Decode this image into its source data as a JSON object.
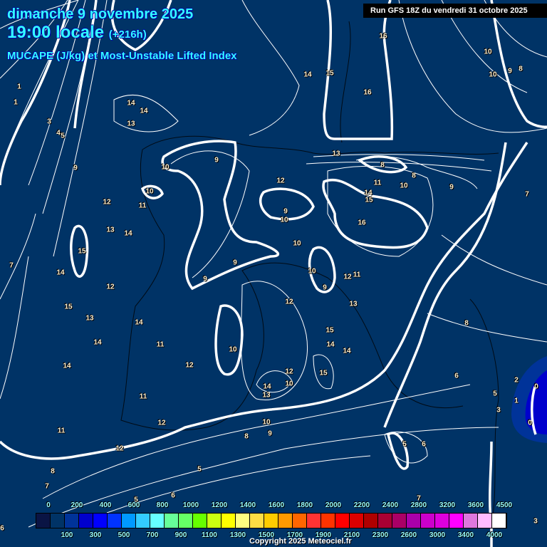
{
  "header": {
    "date": "dimanche 9 novembre 2025",
    "time": "19:00 locale",
    "lead": "(+216h)",
    "product": "MUCAPE (J/kg) et Most-Unstable Lifted Index",
    "run": "Run GFS 18Z du vendredi 31 octobre 2025"
  },
  "contour_labels": [
    "1",
    "1",
    "3",
    "4",
    "5",
    "9",
    "7",
    "14",
    "14",
    "13",
    "10",
    "9",
    "10",
    "12",
    "11",
    "13",
    "14",
    "15",
    "14",
    "12",
    "15",
    "13",
    "14",
    "14",
    "11",
    "14",
    "12",
    "11",
    "12",
    "11",
    "12",
    "8",
    "7",
    "14",
    "15",
    "16",
    "16",
    "10",
    "10",
    "9",
    "8",
    "13",
    "8",
    "8",
    "11",
    "10",
    "9",
    "14",
    "15",
    "12",
    "9",
    "10",
    "16",
    "10",
    "9",
    "9",
    "10",
    "12",
    "11",
    "9",
    "12",
    "13",
    "15",
    "14",
    "14",
    "10",
    "12",
    "14",
    "10",
    "13",
    "15",
    "10",
    "9",
    "8",
    "5",
    "6",
    "5",
    "7",
    "6",
    "5",
    "3",
    "2",
    "1",
    "0",
    "0",
    "8",
    "7",
    "5",
    "6",
    "6",
    "3"
  ],
  "colorbar": {
    "colors": [
      "#0a1444",
      "#003366",
      "#003399",
      "#0000cc",
      "#0000ff",
      "#0033ff",
      "#0099ff",
      "#33ccff",
      "#66ffff",
      "#66ff99",
      "#66ff66",
      "#66ff00",
      "#ccff11",
      "#ffff00",
      "#ffff80",
      "#ffdd44",
      "#ffcc00",
      "#ff9900",
      "#ff6600",
      "#ff3333",
      "#ff3300",
      "#ff0000",
      "#dd0000",
      "#b00000",
      "#aa0033",
      "#aa0066",
      "#aa00aa",
      "#cc00cc",
      "#dd00dd",
      "#ff00ff",
      "#dd77dd",
      "#ffbbff",
      "#ffffff"
    ],
    "top_labels": [
      "0",
      "200",
      "400",
      "600",
      "800",
      "1000",
      "1200",
      "1400",
      "1600",
      "1800",
      "2000",
      "2200",
      "2400",
      "2800",
      "3200",
      "3600",
      "4500"
    ],
    "bottom_labels": [
      "100",
      "300",
      "500",
      "700",
      "900",
      "1100",
      "1300",
      "1500",
      "1700",
      "1900",
      "2100",
      "2300",
      "2600",
      "3000",
      "3400",
      "4000"
    ]
  },
  "footer": {
    "copyright": "Copyright 2025 Meteociel.fr"
  }
}
